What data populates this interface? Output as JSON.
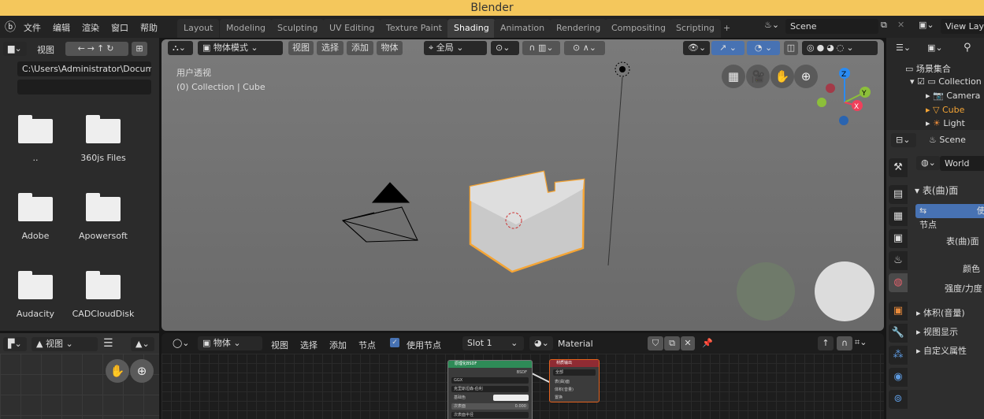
{
  "title": "Blender",
  "menu": [
    "文件",
    "编辑",
    "渲染",
    "窗口",
    "帮助"
  ],
  "workspaces": [
    "Layout",
    "Modeling",
    "Sculpting",
    "UV Editing",
    "Texture Paint",
    "Shading",
    "Animation",
    "Rendering",
    "Compositing",
    "Scripting",
    "+"
  ],
  "active_workspace": "Shading",
  "scene": "Scene",
  "view_layer": "View Layer",
  "filebrowser": {
    "view": "视图",
    "path": "C:\\Users\\Administrator\\Docum..",
    "filter": "",
    "items": [
      "..",
      "360js Files",
      "Adobe",
      "Apowersoft",
      "Audacity",
      "CADCloudDisk"
    ]
  },
  "viewport": {
    "mode": "物体模式",
    "menus": [
      "视图",
      "选择",
      "添加",
      "物体"
    ],
    "orientation": "全局",
    "view_name": "用户透视",
    "collection_info": "(0) Collection | Cube",
    "axes": [
      "X",
      "Y",
      "Z"
    ]
  },
  "outliner": {
    "root": "场景集合",
    "items": [
      "Collection",
      "Camera",
      "Cube",
      "Light"
    ]
  },
  "properties": {
    "scene": "Scene",
    "world": "World",
    "surface_panel": "表(曲)面",
    "use_nodes_button": "使用节点",
    "surface_label": "表(曲)面",
    "color_label": "颜色",
    "strength_label": "强度/力度",
    "panels": [
      "体积(音量)",
      "视图显示",
      "自定义属性"
    ]
  },
  "imageeditor": {
    "view": "视图"
  },
  "nodeeditor": {
    "object": "物体",
    "menus": [
      "视图",
      "选择",
      "添加",
      "节点"
    ],
    "use_nodes": "使用节点",
    "use_nodes_checked": true,
    "slot": "Slot 1",
    "material": "Material",
    "bsdf_node": {
      "title": "原理化BSDF",
      "output": "BSDF",
      "distribution": "GGX",
      "subsurface_method": "克里斯坦森-伯利",
      "base_color": "基础色",
      "subsurface": "次表面",
      "subsurface_value": "0.000",
      "subsurface_radius": "次表面半径"
    },
    "output_node": {
      "title": "材质输出",
      "target": "全部",
      "inputs": [
        "表(曲)面",
        "体积(音量)",
        "置换"
      ]
    }
  },
  "colors": {
    "accent": "#4772b3",
    "selected": "#f5a535",
    "titlebar": "#f4c75c"
  }
}
